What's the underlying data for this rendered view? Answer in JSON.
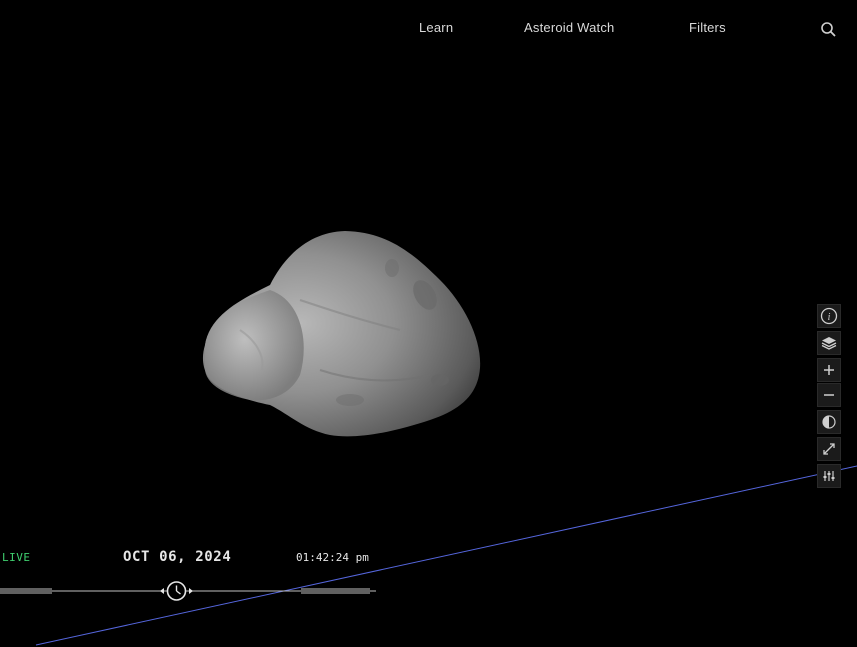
{
  "nav": {
    "items": [
      {
        "label": "Learn"
      },
      {
        "label": "Asteroid Watch"
      },
      {
        "label": "Filters"
      }
    ],
    "search_icon": "search-icon"
  },
  "toolbar": {
    "buttons": [
      {
        "icon": "info-icon"
      },
      {
        "icon": "layers-icon"
      },
      {
        "icon": "zoom-in-icon"
      },
      {
        "icon": "zoom-out-icon"
      },
      {
        "icon": "lighting-icon"
      },
      {
        "icon": "fullscreen-icon"
      },
      {
        "icon": "settings-sliders-icon"
      }
    ]
  },
  "timebar": {
    "live_label": "LIVE",
    "date": "OCT 06, 2024",
    "time": "01:42:24 pm"
  },
  "colors": {
    "background": "#000000",
    "live": "#3fcf6f",
    "orbit_line": "#5566dd",
    "nav_text": "#d9d9d9"
  }
}
